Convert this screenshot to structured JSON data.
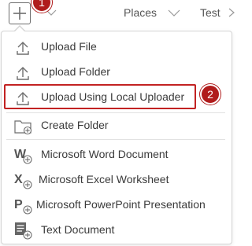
{
  "toolbar": {
    "add_icon": "plus-icon",
    "breadcrumbs": [
      {
        "label": "Places"
      },
      {
        "label": "Test"
      }
    ]
  },
  "hints": {
    "first": "1",
    "second": "2",
    "accent_color": "#b01c1c"
  },
  "menu": {
    "upload_items": [
      {
        "label": "Upload File",
        "icon": "upload-icon"
      },
      {
        "label": "Upload Folder",
        "icon": "upload-icon"
      },
      {
        "label": "Upload Using Local Uploader",
        "icon": "upload-icon"
      }
    ],
    "folder_item": {
      "label": "Create Folder",
      "icon": "folder-icon"
    },
    "document_items": [
      {
        "label": "Microsoft Word Document",
        "icon": "word-icon"
      },
      {
        "label": "Microsoft Excel Worksheet",
        "icon": "excel-icon"
      },
      {
        "label": "Microsoft PowerPoint Presentation",
        "icon": "powerpoint-icon"
      },
      {
        "label": "Text Document",
        "icon": "text-document-icon"
      }
    ]
  }
}
